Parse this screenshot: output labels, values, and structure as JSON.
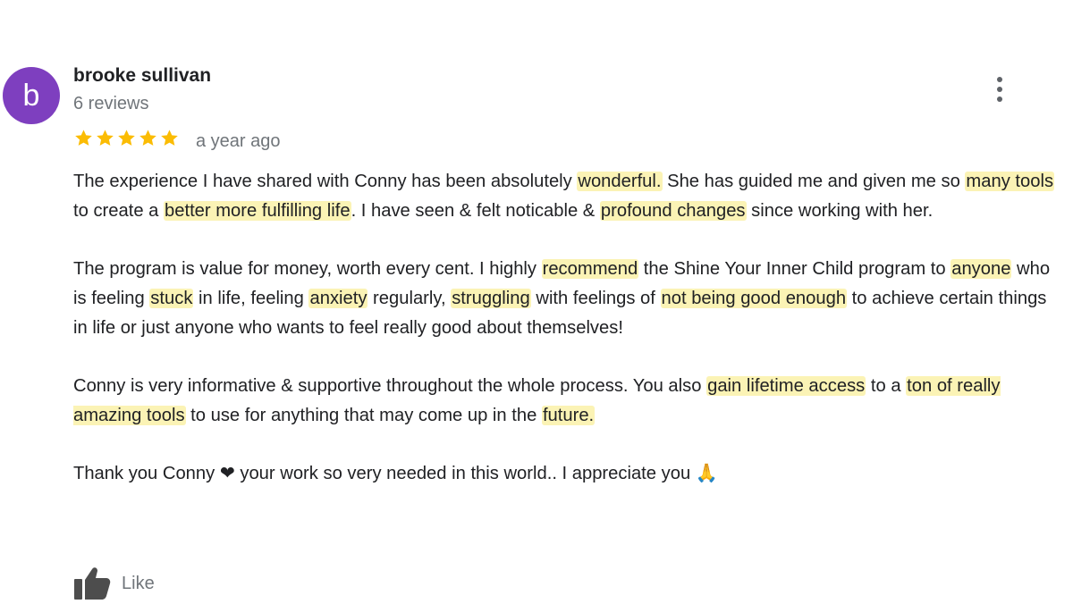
{
  "review": {
    "author": {
      "name": "brooke sullivan",
      "initial": "b",
      "review_count": "6 reviews",
      "avatar_color": "#7e3fbf"
    },
    "rating": 5,
    "star_color": "#fbbc04",
    "timestamp": "a year ago",
    "paragraphs": [
      [
        {
          "t": "The experience I have shared with Conny has been absolutely "
        },
        {
          "t": "wonderful.",
          "hl": true
        },
        {
          "t": " She has guided me and given me so "
        },
        {
          "t": "many tools",
          "hl": true
        },
        {
          "t": " to create a "
        },
        {
          "t": "better more fulfilling life",
          "hl": true
        },
        {
          "t": ". I have seen & felt noticable & "
        },
        {
          "t": "profound changes",
          "hl": true
        },
        {
          "t": " since working with her."
        }
      ],
      [
        {
          "t": "The program is value for money, worth every cent. I highly "
        },
        {
          "t": "recommend",
          "hl": true
        },
        {
          "t": " the Shine Your Inner Child program to "
        },
        {
          "t": "anyone",
          "hl": true
        },
        {
          "t": " who is feeling "
        },
        {
          "t": "stuck",
          "hl": true
        },
        {
          "t": " in life, feeling "
        },
        {
          "t": "anxiety",
          "hl": true
        },
        {
          "t": " regularly, "
        },
        {
          "t": "struggling",
          "hl": true
        },
        {
          "t": " with feelings of "
        },
        {
          "t": "not being good enough",
          "hl": true
        },
        {
          "t": " to achieve certain things in life or just anyone who wants to feel really good about themselves!"
        }
      ],
      [
        {
          "t": "Conny is very informative & supportive throughout the whole process. You also "
        },
        {
          "t": "gain lifetime access",
          "hl": true
        },
        {
          "t": " to a "
        },
        {
          "t": "ton of really amazing tools",
          "hl": true
        },
        {
          "t": " to use for anything that may come up in the "
        },
        {
          "t": "future.",
          "hl": true
        }
      ],
      [
        {
          "t": "Thank you Conny ❤ your work so very needed in this world.. I appreciate you 🙏"
        }
      ]
    ],
    "highlight_color": "#fbf3b5"
  },
  "actions": {
    "like_label": "Like",
    "like_icon": "thumbs-up-icon",
    "more_icon": "more-vert-icon"
  }
}
